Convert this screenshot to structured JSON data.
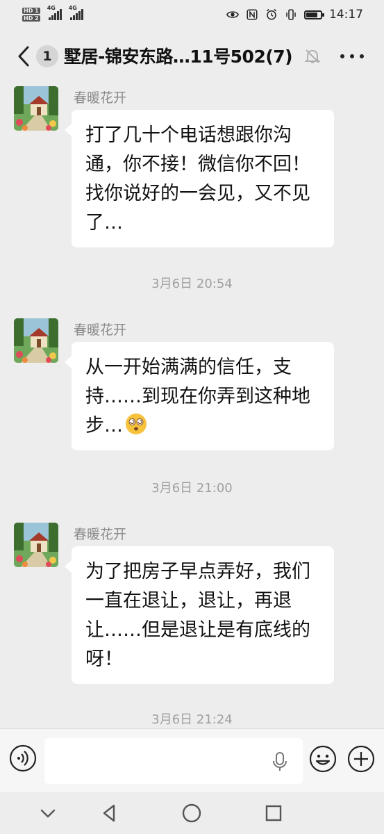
{
  "status_bar": {
    "time": "14:17",
    "network_type_1": "4G",
    "network_type_2": "4G",
    "hd_1": "HD 1",
    "hd_2": "HD 2",
    "battery_level_percent": 80
  },
  "header": {
    "unread_count": "1",
    "title": "墅居-锦安东路…11号502(7)"
  },
  "messages": [
    {
      "sender": "春暖花开",
      "text": "打了几十个电话想跟你沟通，你不接！微信你不回！找你说好的一会见，又不见了…"
    },
    {
      "timestamp": "3月6日 20:54"
    },
    {
      "sender": "春暖花开",
      "text": "从一开始满满的信任，支持……到现在你弄到这种地步…"
    },
    {
      "timestamp": "3月6日 21:00"
    },
    {
      "sender": "春暖花开",
      "text": "为了把房子早点弄好，我们一直在退让，退让，再退让……但是退让是有底线的呀！"
    },
    {
      "timestamp": "3月6日 21:24"
    }
  ],
  "input": {
    "value": "",
    "placeholder": ""
  },
  "icons": {
    "back": "chevron-left-icon",
    "mute": "bell-off-icon",
    "more": "more-dots-icon",
    "voice": "voice-icon",
    "mic": "mic-icon",
    "emoji": "emoji-icon",
    "plus": "plus-icon",
    "nav_down": "chevron-down-icon",
    "nav_back": "triangle-back-icon",
    "nav_home": "circle-home-icon",
    "nav_recent": "square-recent-icon"
  },
  "colors": {
    "background": "#ededed",
    "bubble": "#ffffff",
    "sender": "#8a8a8a",
    "timestamp": "#a0a0a0"
  }
}
